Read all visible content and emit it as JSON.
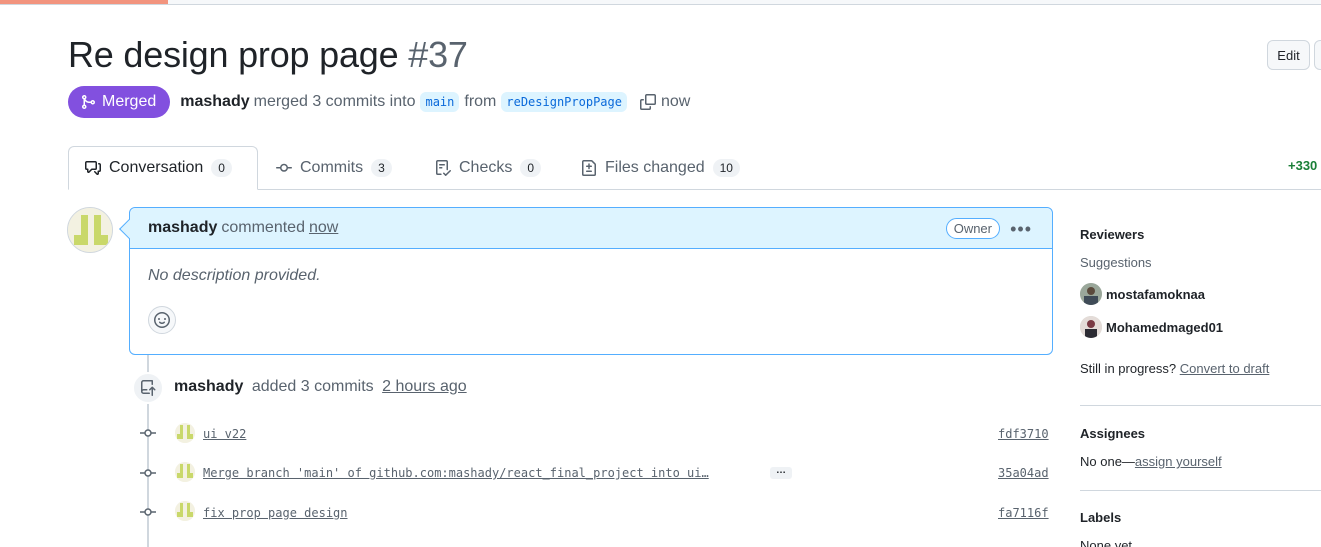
{
  "pr": {
    "title": "Re design prop page",
    "number": "#37",
    "edit_label": "Edit",
    "state": "Merged",
    "author": "mashady",
    "merge_text": "merged 3 commits into",
    "base_branch": "main",
    "from_text": "from",
    "head_branch": "reDesignPropPage",
    "time": "now"
  },
  "tabs": [
    {
      "label": "Conversation",
      "count": "0"
    },
    {
      "label": "Commits",
      "count": "3"
    },
    {
      "label": "Checks",
      "count": "0"
    },
    {
      "label": "Files changed",
      "count": "10"
    }
  ],
  "diffstat": "+330",
  "comment": {
    "author": "mashady",
    "action": "commented",
    "time": "now",
    "badge": "Owner",
    "body": "No description provided."
  },
  "commits_event": {
    "author": "mashady",
    "action": "added 3 commits",
    "time": "2 hours ago"
  },
  "commits": [
    {
      "message": "ui v22",
      "sha": "fdf3710"
    },
    {
      "message": "Merge branch 'main' of github.com:mashady/react_final_project into ui…",
      "sha": "35a04ad",
      "more": "…"
    },
    {
      "message": "fix prop page design",
      "sha": "fa7116f"
    }
  ],
  "sidebar": {
    "reviewers_heading": "Reviewers",
    "suggestions_label": "Suggestions",
    "suggested_reviewers": [
      "mostafamoknaa",
      "Mohamedmaged01"
    ],
    "draft_prompt": "Still in progress?",
    "draft_link": "Convert to draft",
    "assignees_heading": "Assignees",
    "assignees_none": "No one—",
    "assign_self": "assign yourself",
    "labels_heading": "Labels",
    "labels_value": "None yet"
  },
  "colors": {
    "merged": "#8250df",
    "accent_blue": "#0969da",
    "comment_header_bg": "#ddf4ff",
    "diff_added": "#1a7f37"
  }
}
